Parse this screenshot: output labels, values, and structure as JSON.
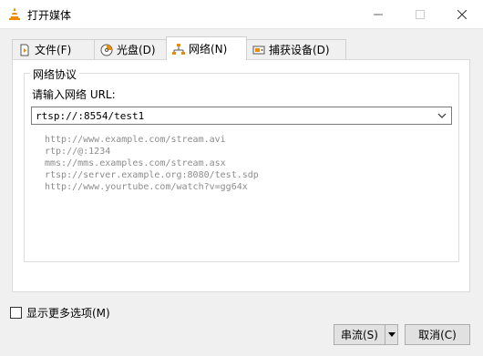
{
  "window": {
    "title": "打开媒体",
    "controls": [
      "minimize",
      "maximize",
      "close"
    ]
  },
  "tabs": [
    {
      "label": "文件(F)",
      "icon": "file-icon",
      "active": false
    },
    {
      "label": "光盘(D)",
      "icon": "disc-icon",
      "active": false
    },
    {
      "label": "网络(N)",
      "icon": "network-icon",
      "active": true
    },
    {
      "label": "捕获设备(D)",
      "icon": "capture-device-icon",
      "active": false
    }
  ],
  "network": {
    "group_title": "网络协议",
    "url_label": "请输入网络 URL:",
    "url_value": "rtsp://:8554/test1",
    "examples": [
      "http://www.example.com/stream.avi",
      "rtp://@:1234",
      "mms://mms.examples.com/stream.asx",
      "rtsp://server.example.org:8080/test.sdp",
      "http://www.yourtube.com/watch?v=gg64x"
    ]
  },
  "options": {
    "more_options_label": "显示更多选项(M)",
    "checked": false
  },
  "buttons": {
    "stream": "串流(S)",
    "cancel": "取消(C)"
  },
  "colors": {
    "accent_orange": "#f08a00",
    "example_text": "#8c8c8c"
  }
}
